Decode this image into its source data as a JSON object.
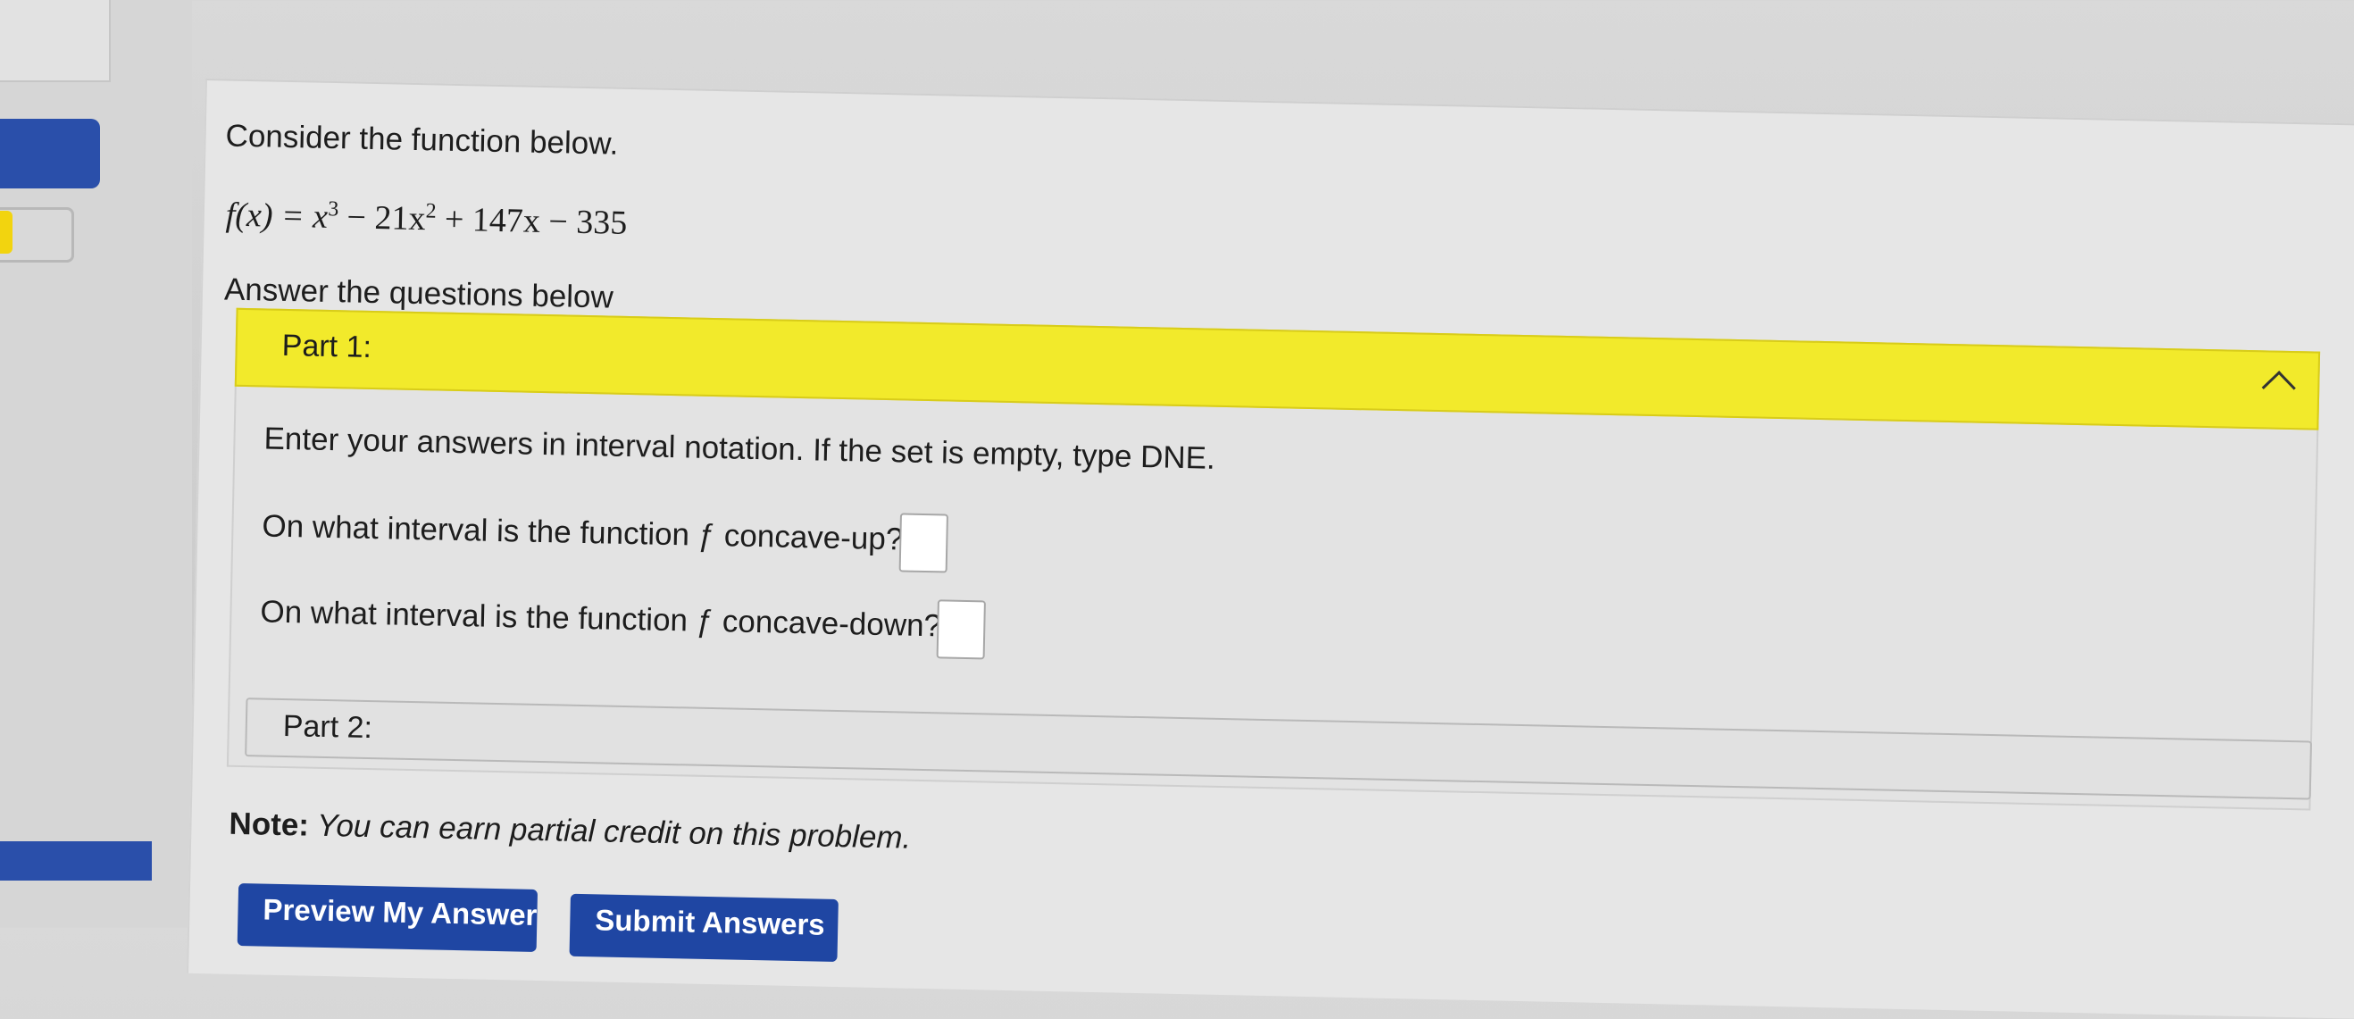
{
  "problem": {
    "intro": "Consider the function below.",
    "function": {
      "lhs": "f(x) = x",
      "exp1": "3",
      "t2": " − 21x",
      "exp2": "2",
      "t3": " + 147x − 335"
    },
    "prompt": "Answer the questions below"
  },
  "part1": {
    "header": "Part 1:",
    "instructions": "Enter your answers in interval notation. If the set is empty, type DNE.",
    "q1": "On what interval is the function ƒ concave-up?",
    "q1_value": "",
    "q2": "On what interval is the function ƒ concave-down?",
    "q2_value": ""
  },
  "part2": {
    "header": "Part 2:"
  },
  "note": {
    "label": "Note:",
    "text": " You can earn partial credit on this problem."
  },
  "buttons": {
    "preview": "Preview My Answers",
    "submit": "Submit Answers"
  },
  "colors": {
    "part_header": "#f2ea2b",
    "button": "#1f46a3"
  }
}
